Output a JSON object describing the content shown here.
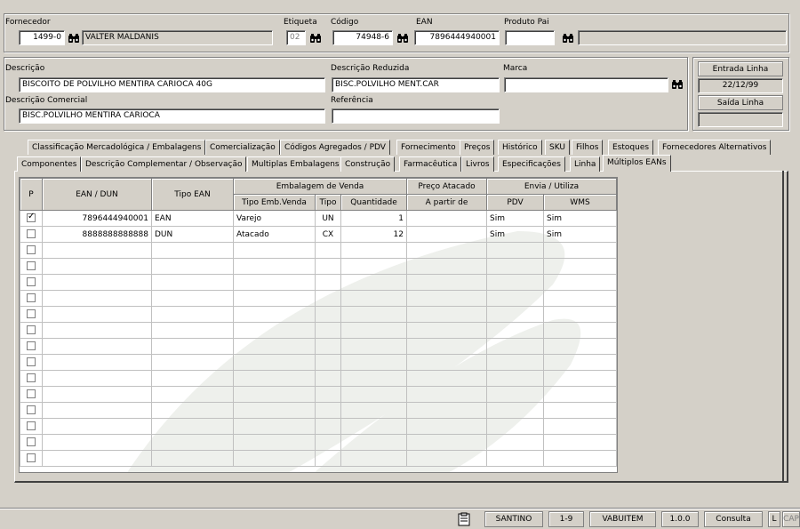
{
  "supplier": {
    "label": "Fornecedor",
    "code": "1499-0",
    "name": "VALTER MALDANIS",
    "etiqueta_label": "Etiqueta",
    "etiqueta_value": "02",
    "codigo_label": "Código",
    "codigo_value": "74948-6",
    "ean_label": "EAN",
    "ean_value": "7896444940001",
    "produto_pai_label": "Produto Pai",
    "produto_pai_code": "",
    "produto_pai_name": ""
  },
  "product": {
    "descricao_label": "Descrição",
    "descricao_value": "BISCOITO DE POLVILHO MENTIRA CARIOCA 40G",
    "descricao_reduzida_label": "Descrição Reduzida",
    "descricao_reduzida_value": "BISC.POLVILHO MENT.CAR",
    "marca_label": "Marca",
    "marca_value": "",
    "descricao_comercial_label": "Descrição Comercial",
    "descricao_comercial_value": "BISC.POLVILHO MENTIRA CARIOCA",
    "referencia_label": "Referência",
    "referencia_value": ""
  },
  "line": {
    "entrada_label": "Entrada Linha",
    "entrada_value": "22/12/99",
    "saida_label": "Saída Linha",
    "saida_value": ""
  },
  "tabs_row1": [
    "Classificação Mercadológica / Embalagens",
    "Comercialização",
    "Códigos Agregados / PDV",
    "Fornecimento",
    "Preços",
    "Histórico",
    "SKU",
    "Filhos",
    "Estoques",
    "Fornecedores Alternativos"
  ],
  "tabs_row2": [
    "Componentes",
    "Descrição Complementar / Observação",
    "Multiplas Embalagens",
    "Construção",
    "Farmacêutica",
    "Livros",
    "Especificações",
    "Linha",
    "Múltiplos EANs"
  ],
  "grid": {
    "headers": {
      "p": "P",
      "ean": "EAN / DUN",
      "tipo_ean": "Tipo EAN",
      "embalagem_venda": "Embalagem de Venda",
      "tipo_emb_venda": "Tipo Emb.Venda",
      "tipo": "Tipo",
      "quantidade": "Quantidade",
      "preco_atacado": "Preço Atacado",
      "a_partir_de": "A partir de",
      "envia_utiliza": "Envia / Utiliza",
      "pdv": "PDV",
      "wms": "WMS"
    },
    "rows": [
      {
        "checked": true,
        "ean": "7896444940001",
        "tipo_ean": "EAN",
        "tipo_emb": "Varejo",
        "tipo": "UN",
        "qtd": "1",
        "a_partir": "",
        "pdv": "Sim",
        "wms": "Sim"
      },
      {
        "checked": false,
        "ean": "8888888888888",
        "tipo_ean": "DUN",
        "tipo_emb": "Atacado",
        "tipo": "CX",
        "qtd": "12",
        "a_partir": "",
        "pdv": "Sim",
        "wms": "Sim"
      }
    ],
    "empty_rows": 14
  },
  "statusbar": {
    "user": "SANTINO",
    "page": "1-9",
    "module": "VABUITEM",
    "version": "1.0.0",
    "mode": "Consulta",
    "flag": "L",
    "caps": "CAP"
  }
}
